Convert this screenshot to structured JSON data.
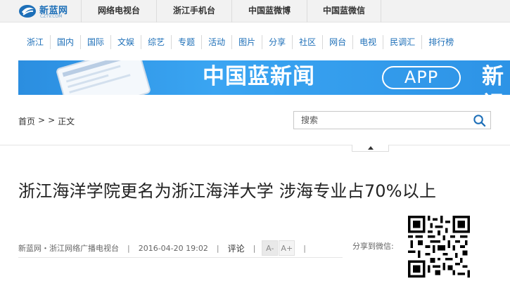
{
  "logo": {
    "name": "新蓝网",
    "domain": "CZTV.COM"
  },
  "top_links": [
    "网络电视台",
    "浙江手机台",
    "中国蓝微博",
    "中国蓝微信"
  ],
  "nav": [
    "浙江",
    "国内",
    "国际",
    "文娱",
    "综艺",
    "专题",
    "活动",
    "图片",
    "分享",
    "社区",
    "网台",
    "电视",
    "民调汇",
    "排行榜"
  ],
  "banner": {
    "title": "中国蓝新闻",
    "app_label": "APP",
    "tail": "新视"
  },
  "breadcrumb": {
    "home": "首页",
    "sep1": ">",
    "sep2": ">",
    "current": "正文"
  },
  "search": {
    "placeholder": "搜索"
  },
  "article": {
    "title": "浙江海洋学院更名为浙江海洋大学 涉海专业占70%以上",
    "source": "新蓝网・浙江网络广播电视台",
    "sep": "|",
    "datetime": "2016-04-20 19:02",
    "comment_label": "评论",
    "font_smaller": "A-",
    "font_larger": "A+"
  },
  "share": {
    "label": "分享到微信:"
  },
  "colors": {
    "brand_blue": "#1d6fb8",
    "banner_blue": "#3aa5f2"
  },
  "icons": {
    "search": "search-icon",
    "collapse": "chevron-up-icon",
    "qr": "qr-code-icon"
  }
}
